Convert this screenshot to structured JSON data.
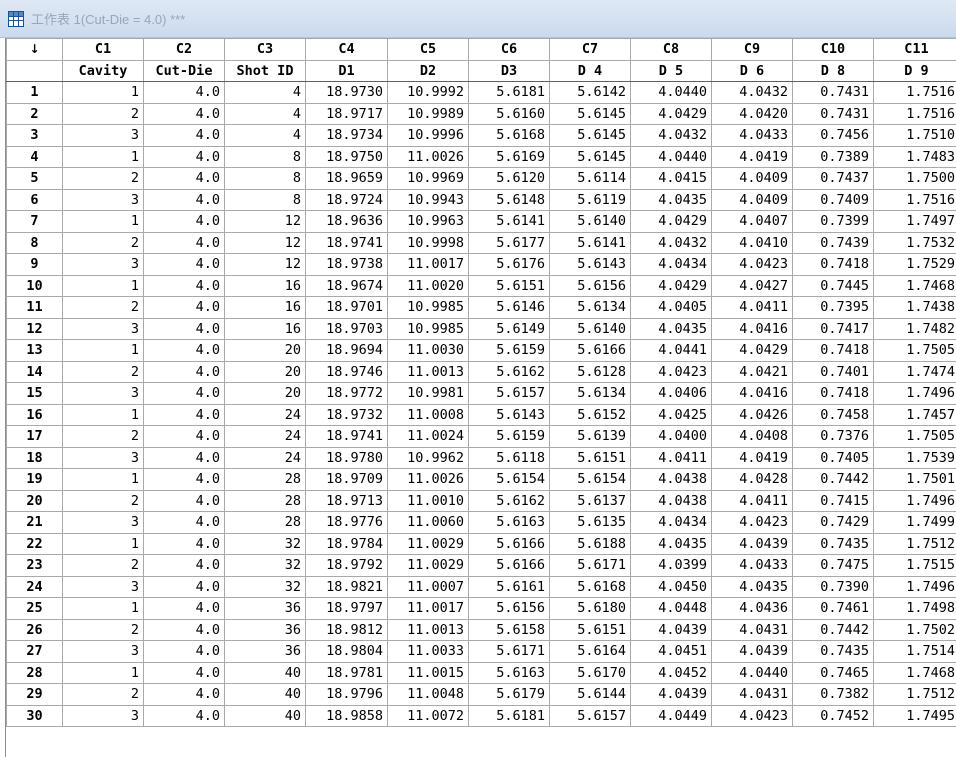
{
  "window": {
    "title": "工作表 1(Cut-Die = 4.0) ***",
    "icon": "worksheet-grid-icon"
  },
  "sheet": {
    "corner_label": "↓",
    "column_ids": [
      "C1",
      "C2",
      "C3",
      "C4",
      "C5",
      "C6",
      "C7",
      "C8",
      "C9",
      "C10",
      "C11"
    ],
    "column_names": [
      "Cavity",
      "Cut-Die",
      "Shot ID",
      "D1",
      "D2",
      "D3",
      "D 4",
      "D 5",
      "D 6",
      "D 8",
      "D 9"
    ],
    "rows": [
      {
        "n": "1",
        "cells": [
          "1",
          "4.0",
          "4",
          "18.9730",
          "10.9992",
          "5.6181",
          "5.6142",
          "4.0440",
          "4.0432",
          "0.7431",
          "1.7516"
        ]
      },
      {
        "n": "2",
        "cells": [
          "2",
          "4.0",
          "4",
          "18.9717",
          "10.9989",
          "5.6160",
          "5.6145",
          "4.0429",
          "4.0420",
          "0.7431",
          "1.7516"
        ]
      },
      {
        "n": "3",
        "cells": [
          "3",
          "4.0",
          "4",
          "18.9734",
          "10.9996",
          "5.6168",
          "5.6145",
          "4.0432",
          "4.0433",
          "0.7456",
          "1.7510"
        ]
      },
      {
        "n": "4",
        "cells": [
          "1",
          "4.0",
          "8",
          "18.9750",
          "11.0026",
          "5.6169",
          "5.6145",
          "4.0440",
          "4.0419",
          "0.7389",
          "1.7483"
        ]
      },
      {
        "n": "5",
        "cells": [
          "2",
          "4.0",
          "8",
          "18.9659",
          "10.9969",
          "5.6120",
          "5.6114",
          "4.0415",
          "4.0409",
          "0.7437",
          "1.7500"
        ]
      },
      {
        "n": "6",
        "cells": [
          "3",
          "4.0",
          "8",
          "18.9724",
          "10.9943",
          "5.6148",
          "5.6119",
          "4.0435",
          "4.0409",
          "0.7409",
          "1.7516"
        ]
      },
      {
        "n": "7",
        "cells": [
          "1",
          "4.0",
          "12",
          "18.9636",
          "10.9963",
          "5.6141",
          "5.6140",
          "4.0429",
          "4.0407",
          "0.7399",
          "1.7497"
        ]
      },
      {
        "n": "8",
        "cells": [
          "2",
          "4.0",
          "12",
          "18.9741",
          "10.9998",
          "5.6177",
          "5.6141",
          "4.0432",
          "4.0410",
          "0.7439",
          "1.7532"
        ]
      },
      {
        "n": "9",
        "cells": [
          "3",
          "4.0",
          "12",
          "18.9738",
          "11.0017",
          "5.6176",
          "5.6143",
          "4.0434",
          "4.0423",
          "0.7418",
          "1.7529"
        ]
      },
      {
        "n": "10",
        "cells": [
          "1",
          "4.0",
          "16",
          "18.9674",
          "11.0020",
          "5.6151",
          "5.6156",
          "4.0429",
          "4.0427",
          "0.7445",
          "1.7468"
        ]
      },
      {
        "n": "11",
        "cells": [
          "2",
          "4.0",
          "16",
          "18.9701",
          "10.9985",
          "5.6146",
          "5.6134",
          "4.0405",
          "4.0411",
          "0.7395",
          "1.7438"
        ]
      },
      {
        "n": "12",
        "cells": [
          "3",
          "4.0",
          "16",
          "18.9703",
          "10.9985",
          "5.6149",
          "5.6140",
          "4.0435",
          "4.0416",
          "0.7417",
          "1.7482"
        ]
      },
      {
        "n": "13",
        "cells": [
          "1",
          "4.0",
          "20",
          "18.9694",
          "11.0030",
          "5.6159",
          "5.6166",
          "4.0441",
          "4.0429",
          "0.7418",
          "1.7505"
        ]
      },
      {
        "n": "14",
        "cells": [
          "2",
          "4.0",
          "20",
          "18.9746",
          "11.0013",
          "5.6162",
          "5.6128",
          "4.0423",
          "4.0421",
          "0.7401",
          "1.7474"
        ]
      },
      {
        "n": "15",
        "cells": [
          "3",
          "4.0",
          "20",
          "18.9772",
          "10.9981",
          "5.6157",
          "5.6134",
          "4.0406",
          "4.0416",
          "0.7418",
          "1.7496"
        ]
      },
      {
        "n": "16",
        "cells": [
          "1",
          "4.0",
          "24",
          "18.9732",
          "11.0008",
          "5.6143",
          "5.6152",
          "4.0425",
          "4.0426",
          "0.7458",
          "1.7457"
        ]
      },
      {
        "n": "17",
        "cells": [
          "2",
          "4.0",
          "24",
          "18.9741",
          "11.0024",
          "5.6159",
          "5.6139",
          "4.0400",
          "4.0408",
          "0.7376",
          "1.7505"
        ]
      },
      {
        "n": "18",
        "cells": [
          "3",
          "4.0",
          "24",
          "18.9780",
          "10.9962",
          "5.6118",
          "5.6151",
          "4.0411",
          "4.0419",
          "0.7405",
          "1.7539"
        ]
      },
      {
        "n": "19",
        "cells": [
          "1",
          "4.0",
          "28",
          "18.9709",
          "11.0026",
          "5.6154",
          "5.6154",
          "4.0438",
          "4.0428",
          "0.7442",
          "1.7501"
        ]
      },
      {
        "n": "20",
        "cells": [
          "2",
          "4.0",
          "28",
          "18.9713",
          "11.0010",
          "5.6162",
          "5.6137",
          "4.0438",
          "4.0411",
          "0.7415",
          "1.7496"
        ]
      },
      {
        "n": "21",
        "cells": [
          "3",
          "4.0",
          "28",
          "18.9776",
          "11.0060",
          "5.6163",
          "5.6135",
          "4.0434",
          "4.0423",
          "0.7429",
          "1.7499"
        ]
      },
      {
        "n": "22",
        "cells": [
          "1",
          "4.0",
          "32",
          "18.9784",
          "11.0029",
          "5.6166",
          "5.6188",
          "4.0435",
          "4.0439",
          "0.7435",
          "1.7512"
        ]
      },
      {
        "n": "23",
        "cells": [
          "2",
          "4.0",
          "32",
          "18.9792",
          "11.0029",
          "5.6166",
          "5.6171",
          "4.0399",
          "4.0433",
          "0.7475",
          "1.7515"
        ]
      },
      {
        "n": "24",
        "cells": [
          "3",
          "4.0",
          "32",
          "18.9821",
          "11.0007",
          "5.6161",
          "5.6168",
          "4.0450",
          "4.0435",
          "0.7390",
          "1.7496"
        ]
      },
      {
        "n": "25",
        "cells": [
          "1",
          "4.0",
          "36",
          "18.9797",
          "11.0017",
          "5.6156",
          "5.6180",
          "4.0448",
          "4.0436",
          "0.7461",
          "1.7498"
        ]
      },
      {
        "n": "26",
        "cells": [
          "2",
          "4.0",
          "36",
          "18.9812",
          "11.0013",
          "5.6158",
          "5.6151",
          "4.0439",
          "4.0431",
          "0.7442",
          "1.7502"
        ]
      },
      {
        "n": "27",
        "cells": [
          "3",
          "4.0",
          "36",
          "18.9804",
          "11.0033",
          "5.6171",
          "5.6164",
          "4.0451",
          "4.0439",
          "0.7435",
          "1.7514"
        ]
      },
      {
        "n": "28",
        "cells": [
          "1",
          "4.0",
          "40",
          "18.9781",
          "11.0015",
          "5.6163",
          "5.6170",
          "4.0452",
          "4.0440",
          "0.7465",
          "1.7468"
        ]
      },
      {
        "n": "29",
        "cells": [
          "2",
          "4.0",
          "40",
          "18.9796",
          "11.0048",
          "5.6179",
          "5.6144",
          "4.0439",
          "4.0431",
          "0.7382",
          "1.7512"
        ]
      },
      {
        "n": "30",
        "cells": [
          "3",
          "4.0",
          "40",
          "18.9858",
          "11.0072",
          "5.6181",
          "5.6157",
          "4.0449",
          "4.0423",
          "0.7452",
          "1.7495"
        ]
      }
    ]
  }
}
